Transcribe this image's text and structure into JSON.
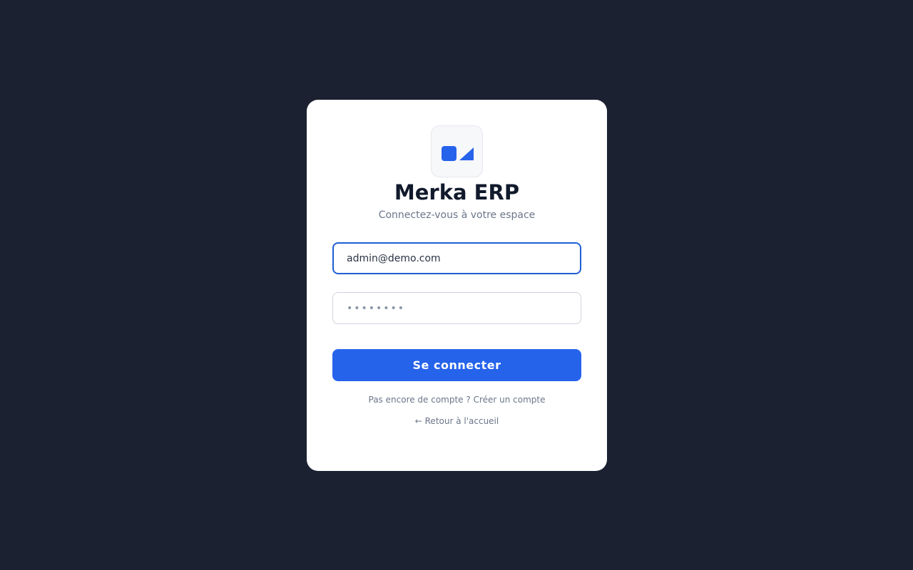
{
  "app": {
    "title": "Merka ERP",
    "subtitle": "Connectez-vous à votre espace"
  },
  "logo": {
    "icon": "merka-logo-icon",
    "accent": "#2563eb"
  },
  "form": {
    "email_value": "admin@demo.com",
    "password_placeholder": "••••••••",
    "submit_label": "Se connecter"
  },
  "links": {
    "signup_prompt": "Pas encore de compte ?",
    "signup_label": "Créer un compte",
    "back_label": "← Retour à l'accueil"
  },
  "colors": {
    "background": "#1b2130",
    "card": "#ffffff",
    "primary": "#2563eb",
    "focus_border": "#1f5fd4",
    "muted_text": "#6b7689"
  }
}
